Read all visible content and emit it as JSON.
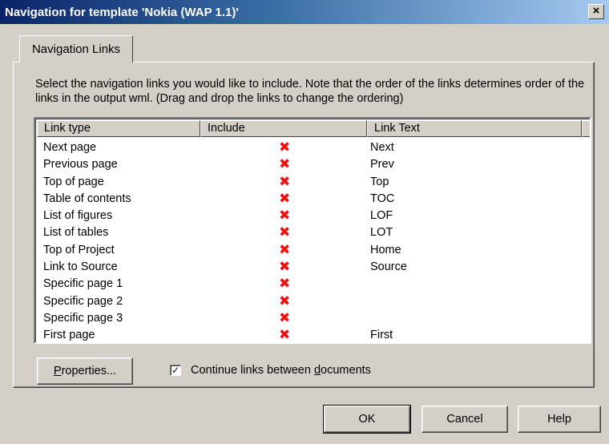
{
  "window": {
    "title": "Navigation for template 'Nokia (WAP 1.1)'",
    "close_glyph": "×"
  },
  "tabs": [
    {
      "label": "Navigation Links",
      "active": true
    }
  ],
  "description": "Select the navigation links you would like to include.  Note that the order of the links determines order of the links in the output wml.  (Drag and drop the links to change the ordering)",
  "list": {
    "columns": [
      "Link type",
      "Include",
      "Link Text"
    ],
    "rows": [
      {
        "type": "Next page",
        "include": "✖",
        "text": "Next"
      },
      {
        "type": "Previous page",
        "include": "✖",
        "text": "Prev"
      },
      {
        "type": "Top of page",
        "include": "✖",
        "text": "Top"
      },
      {
        "type": "Table of contents",
        "include": "✖",
        "text": "TOC"
      },
      {
        "type": "List of figures",
        "include": "✖",
        "text": "LOF"
      },
      {
        "type": "List of tables",
        "include": "✖",
        "text": "LOT"
      },
      {
        "type": "Top of Project",
        "include": "✖",
        "text": "Home"
      },
      {
        "type": "Link to Source",
        "include": "✖",
        "text": "Source"
      },
      {
        "type": "Specific page 1",
        "include": "✖",
        "text": ""
      },
      {
        "type": "Specific page 2",
        "include": "✖",
        "text": ""
      },
      {
        "type": "Specific page 3",
        "include": "✖",
        "text": ""
      },
      {
        "type": "First page",
        "include": "✖",
        "text": "First"
      }
    ],
    "include_icon": "red-x-icon",
    "include_color": "#e01010"
  },
  "properties_button": {
    "label_underlined": "P",
    "label_rest": "roperties..."
  },
  "continue_links": {
    "checked": true,
    "check_glyph": "✓",
    "label_before": "Continue links between ",
    "label_underlined": "d",
    "label_after": "ocuments"
  },
  "footer": {
    "ok": "OK",
    "cancel": "Cancel",
    "help": "Help"
  },
  "colors": {
    "title_start": "#0a246a",
    "title_end": "#a6caf0",
    "face": "#d4d0c8"
  }
}
